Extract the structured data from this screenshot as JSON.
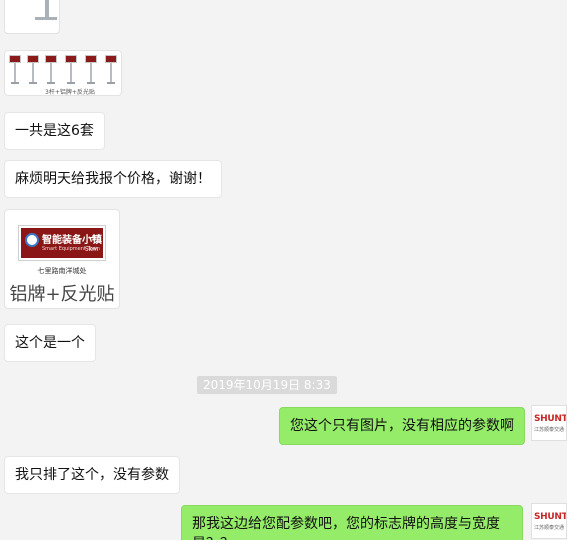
{
  "messages": {
    "total_sets": "一共是这6套",
    "request_price": "麻烦明天给我报个价格，谢谢！",
    "this_one": "这个是一个",
    "no_params": "我只排了这个，没有参数",
    "reply_only_images": "您这个只有图片，没有相应的参数啊",
    "reply_params": "那我这边给您配参数吧，您的标志牌的高度与宽度是？？"
  },
  "images": {
    "six_signs_caption": "3杆+铝牌+反光贴",
    "sign": {
      "title": "智能装备小镇",
      "subtitle": "Smart Equipment Town",
      "arrow": "➔",
      "distance": "5km",
      "location": "七里路南洋城处",
      "caption": "铝牌+反光贴"
    }
  },
  "timestamp": "2019年10月19日 8:33",
  "avatar": {
    "brand": "SHUNTAI",
    "sub": "江苏顺泰交通"
  },
  "colors": {
    "background": "#f3f3f3",
    "incoming_bubble": "#ffffff",
    "outgoing_bubble": "#95ec69",
    "sign_red": "#8a1616",
    "timestamp_bg": "#dadada"
  }
}
